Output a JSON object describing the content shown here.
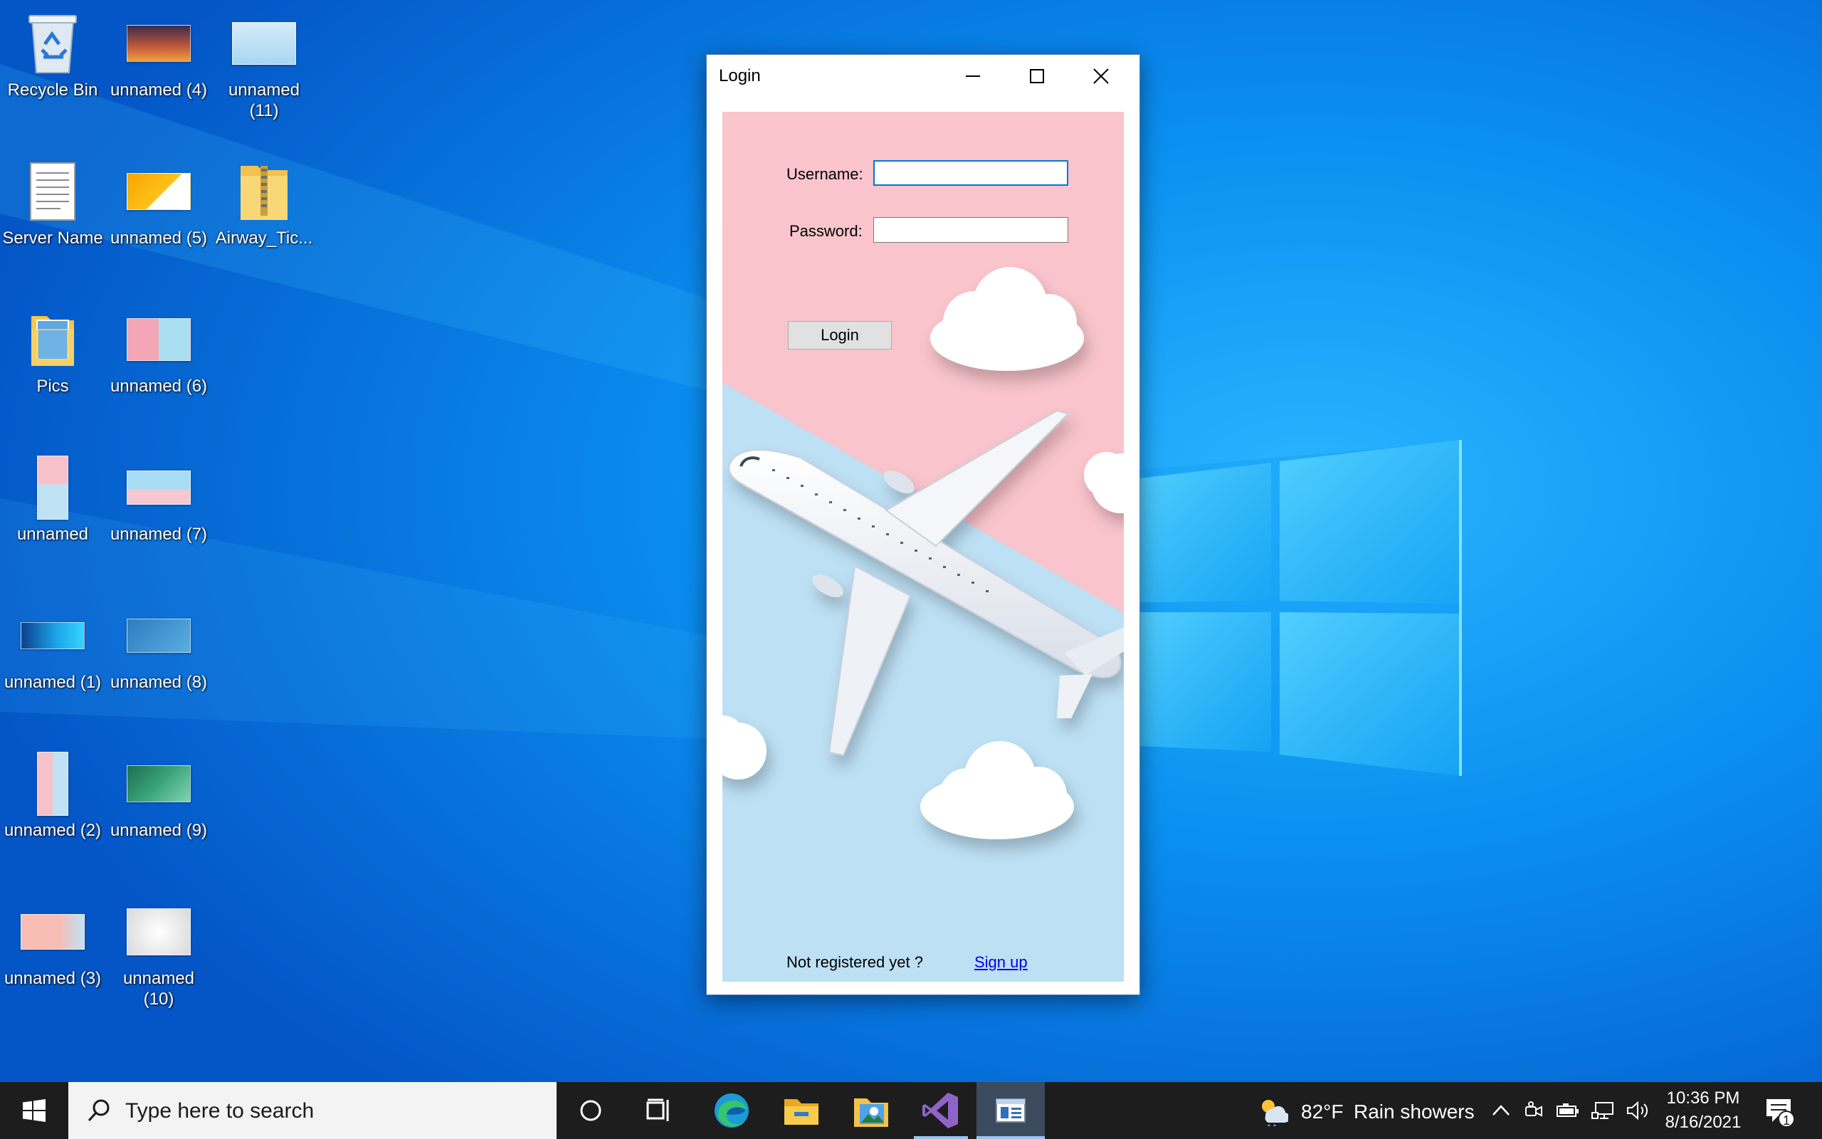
{
  "desktop": {
    "icons": [
      {
        "id": "recycle-bin",
        "label": "Recycle Bin"
      },
      {
        "id": "unnamed-4",
        "label": "unnamed (4)"
      },
      {
        "id": "unnamed-11",
        "label": "unnamed\n(11)"
      },
      {
        "id": "server-name",
        "label": "Server Name"
      },
      {
        "id": "unnamed-5",
        "label": "unnamed (5)"
      },
      {
        "id": "airway-tic",
        "label": "Airway_Tic..."
      },
      {
        "id": "pics",
        "label": "Pics"
      },
      {
        "id": "unnamed-6",
        "label": "unnamed (6)"
      },
      {
        "id": "unnamed",
        "label": "unnamed"
      },
      {
        "id": "unnamed-7",
        "label": "unnamed (7)"
      },
      {
        "id": "unnamed-1",
        "label": "unnamed (1)"
      },
      {
        "id": "unnamed-8",
        "label": "unnamed (8)"
      },
      {
        "id": "unnamed-2",
        "label": "unnamed (2)"
      },
      {
        "id": "unnamed-9",
        "label": "unnamed (9)"
      },
      {
        "id": "unnamed-3",
        "label": "unnamed (3)"
      },
      {
        "id": "unnamed-10",
        "label": "unnamed\n(10)"
      }
    ]
  },
  "login_window": {
    "title": "Login",
    "username_label": "Username:",
    "username_value": "",
    "password_label": "Password:",
    "password_value": "",
    "login_button": "Login",
    "not_registered": "Not registered yet ?",
    "signup_link": "Sign up",
    "colors": {
      "pink": "#f9c4cb",
      "sky": "#bde0f4"
    }
  },
  "taskbar": {
    "search_placeholder": "Type here to search",
    "weather_temp": "82°F",
    "weather_desc": "Rain showers",
    "time": "10:36 PM",
    "date": "8/16/2021",
    "notification_count": "1",
    "pinned": [
      "cortana-icon",
      "task-view-icon",
      "edge-icon",
      "file-explorer-icon",
      "photos-icon",
      "visual-studio-icon",
      "login-app-icon"
    ]
  }
}
